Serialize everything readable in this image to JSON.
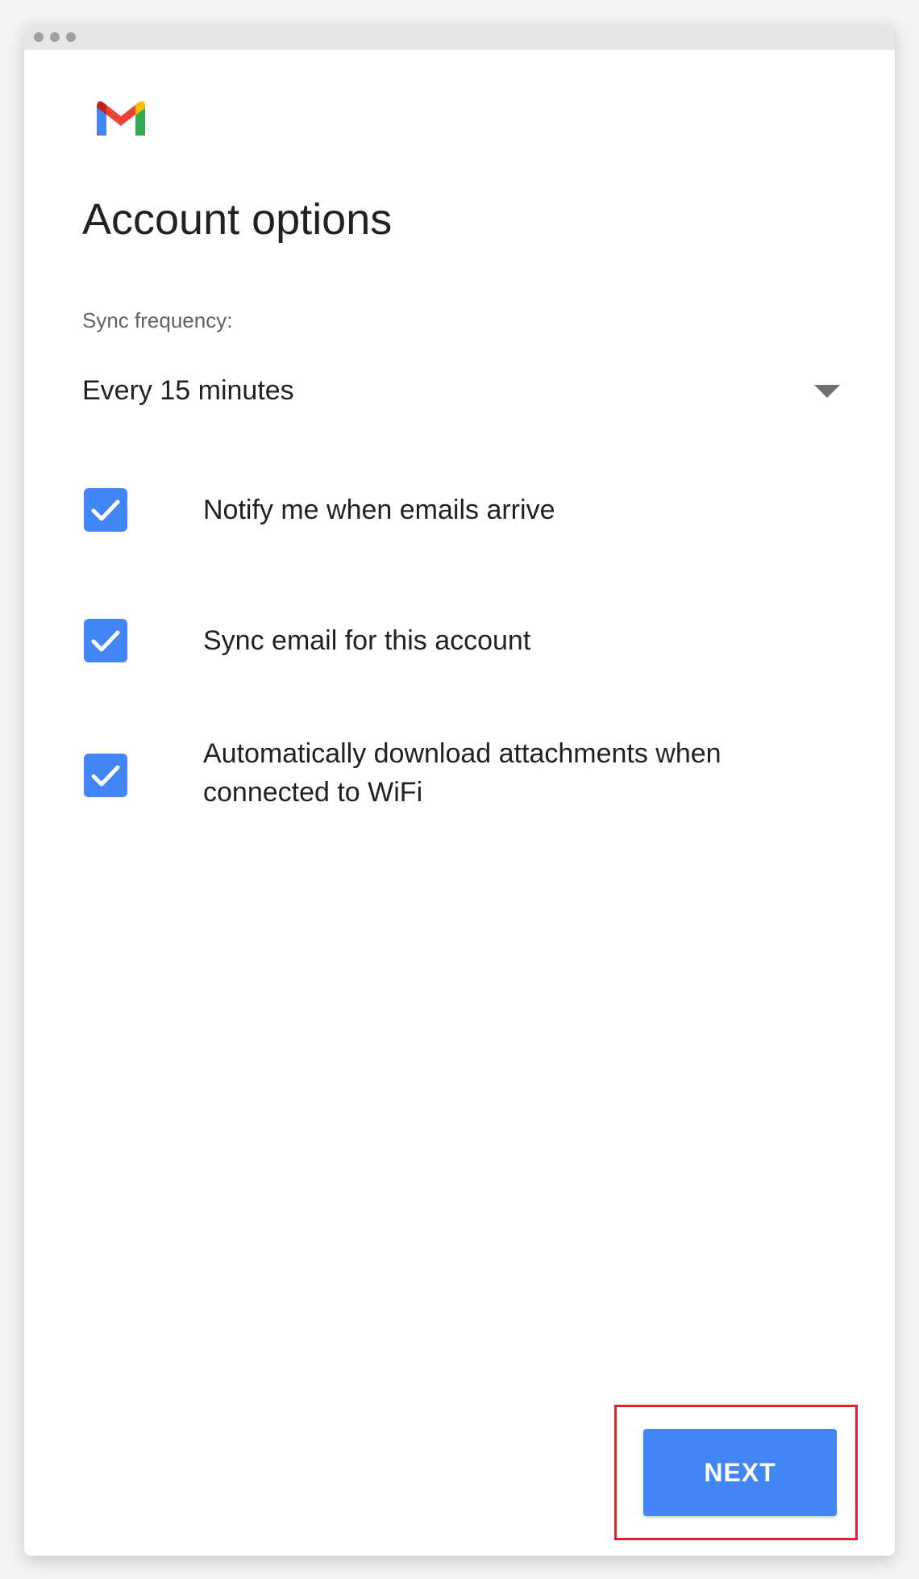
{
  "window": {
    "controls": [
      "dot-1",
      "dot-2",
      "dot-3"
    ]
  },
  "brand": {
    "logo_icon": "gmail-logo-icon",
    "colors": {
      "red": "#ea4335",
      "blue": "#4285f4",
      "green": "#34a853",
      "yellow": "#fbbc04",
      "accent": "#4285f4",
      "highlight": "#e0202a"
    }
  },
  "page": {
    "title": "Account options"
  },
  "sync": {
    "label": "Sync frequency:",
    "selected": "Every 15 minutes",
    "caret_icon": "caret-down-icon"
  },
  "options": [
    {
      "label": "Notify me when emails arrive",
      "checked": true
    },
    {
      "label": "Sync email for this account",
      "checked": true
    },
    {
      "label": "Automatically download attachments when connected to WiFi",
      "checked": true
    }
  ],
  "actions": {
    "next_label": "NEXT"
  }
}
